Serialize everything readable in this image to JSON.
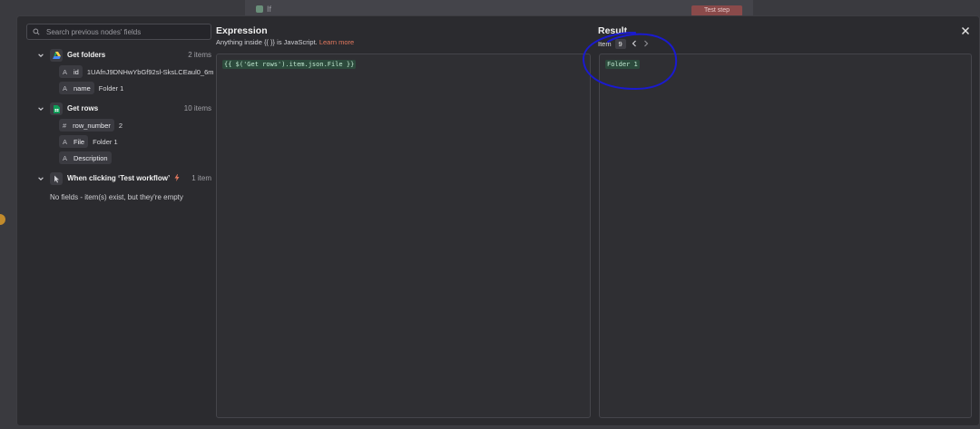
{
  "background": {
    "title": "If",
    "button_label": "Test step"
  },
  "search": {
    "placeholder": "Search previous nodes' fields"
  },
  "nodes": [
    {
      "title": "Get folders",
      "count": "2 items",
      "icon": "google-drive-icon",
      "fields": [
        {
          "type": "A",
          "name": "id",
          "value": "1UAfnJ9DNHwYbGf92sl-SksLCEaul0_6m"
        },
        {
          "type": "A",
          "name": "name",
          "value": "Folder 1"
        }
      ]
    },
    {
      "title": "Get rows",
      "count": "10 items",
      "icon": "google-sheets-icon",
      "fields": [
        {
          "type": "#",
          "name": "row_number",
          "value": "2"
        },
        {
          "type": "A",
          "name": "File",
          "value": "Folder 1"
        },
        {
          "type": "A",
          "name": "Description",
          "value": ""
        }
      ]
    },
    {
      "title": "When clicking ‘Test workflow’",
      "count": "1 item",
      "icon": "cursor-icon",
      "empty_note": "No fields - item(s) exist, but they're empty"
    }
  ],
  "expression": {
    "title": "Expression",
    "subtitle_prefix": "Anything inside ",
    "subtitle_braces": "{{ }}",
    "subtitle_suffix": " is JavaScript. ",
    "learn_more": "Learn more",
    "code": "{{ $('Get rows').item.json.File }}"
  },
  "result": {
    "title": "Result",
    "item_label": "Item",
    "item_number": "9",
    "value": "Folder 1"
  },
  "colors": {
    "modal_bg": "#2b2b2f",
    "accent_link": "#e3785e",
    "code_highlight": "#2c4a3c",
    "annotation": "#1a1ad0"
  }
}
